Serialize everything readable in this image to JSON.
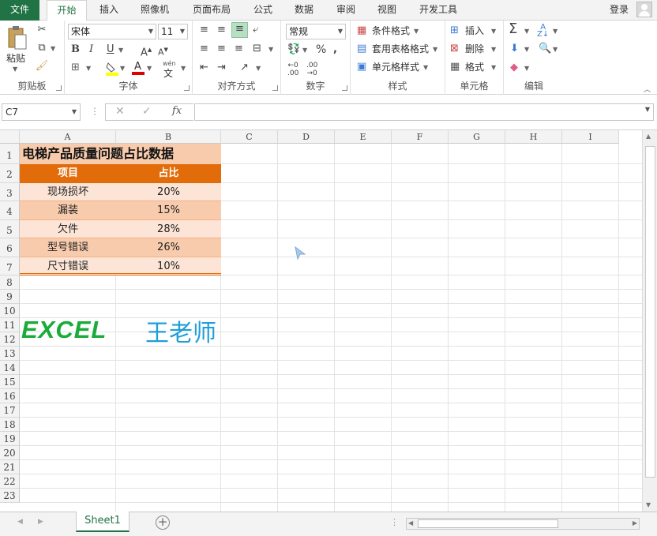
{
  "ribbon_tabs": [
    "文件",
    "开始",
    "插入",
    "照像机",
    "页面布局",
    "公式",
    "数据",
    "审阅",
    "视图",
    "开发工具"
  ],
  "login_label": "登录",
  "clipboard": {
    "paste_label": "粘贴",
    "group_label": "剪贴板"
  },
  "font": {
    "name": "宋体",
    "size": "11",
    "group_label": "字体",
    "phonetic_glyph": "wén"
  },
  "alignment": {
    "group_label": "对齐方式"
  },
  "number": {
    "format": "常规",
    "group_label": "数字"
  },
  "styles": {
    "conditional": "条件格式",
    "table": "套用表格格式",
    "cell": "单元格样式",
    "group_label": "样式"
  },
  "cells": {
    "insert": "插入",
    "delete": "删除",
    "format": "格式",
    "group_label": "单元格"
  },
  "editing": {
    "group_label": "编辑"
  },
  "name_box": "C7",
  "fx_label": "fx",
  "column_headers": [
    "A",
    "B",
    "C",
    "D",
    "E",
    "F",
    "G",
    "H",
    "I"
  ],
  "row_numbers": [
    "1",
    "2",
    "3",
    "4",
    "5",
    "6",
    "7",
    "8",
    "9",
    "10",
    "11",
    "12",
    "13",
    "14",
    "15",
    "16",
    "17",
    "18",
    "19",
    "20",
    "21",
    "22",
    "23"
  ],
  "table": {
    "title": "电梯产品质量问题占比数据",
    "header": [
      "项目",
      "占比"
    ],
    "rows": [
      {
        "item": "现场损坏",
        "pct": "20%"
      },
      {
        "item": "漏装",
        "pct": "15%"
      },
      {
        "item": "欠件",
        "pct": "28%"
      },
      {
        "item": "型号错误",
        "pct": "26%"
      },
      {
        "item": "尺寸错误",
        "pct": "10%"
      }
    ]
  },
  "watermark": {
    "left": "EXCEL",
    "right": "王老师"
  },
  "colors": {
    "excel_green": "#217346",
    "header_orange": "#e26b0a",
    "title_fill": "#f8cbad",
    "band_light": "#fce4d6",
    "band_mid": "#f8cbad",
    "watermark_green": "#1aab3a",
    "watermark_blue": "#1e9fd8"
  },
  "sheet_tab": "Sheet1"
}
